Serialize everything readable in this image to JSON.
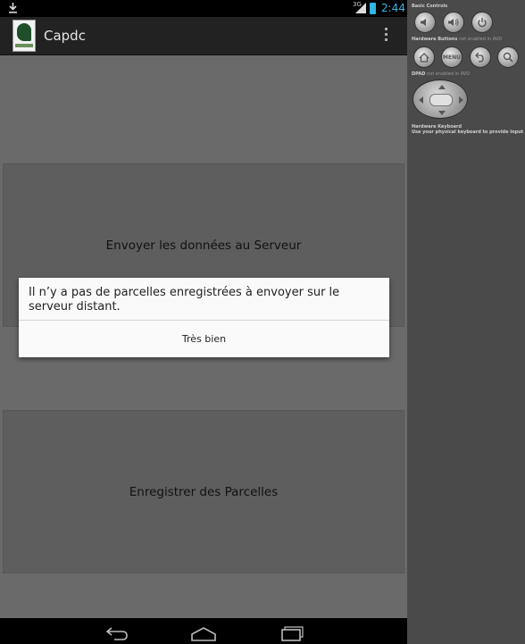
{
  "status_bar": {
    "network": "3G",
    "time": "2:44"
  },
  "app": {
    "title": "Capdc"
  },
  "buttons": {
    "send": "Envoyer les données au Serveur",
    "save": "Enregistrer des Parcelles"
  },
  "dialog": {
    "message": "Il n’y a pas de parcelles enregistrées à envoyer sur le serveur distant.",
    "ok": "Très bien"
  },
  "emulator": {
    "basic_controls": "Basic Controls",
    "hardware_buttons": "Hardware Buttons",
    "hardware_buttons_note": "not enabled in AVD",
    "menu": "MENU",
    "dpad": "DPAD",
    "dpad_note": "not enabled in AVD",
    "hardware_keyboard": "Hardware Keyboard",
    "keyboard_note": "Use your physical keyboard to provide input"
  },
  "colors": {
    "accent": "#33b5e5",
    "action_bar": "#222222",
    "screen_bg": "#6a6a6a",
    "panel_bg": "#4a4a4a"
  },
  "icons": [
    "download-icon",
    "signal-icon",
    "battery-icon",
    "overflow-menu-icon",
    "back-icon",
    "home-icon",
    "recent-apps-icon",
    "volume-down-icon",
    "volume-up-icon",
    "power-icon",
    "search-icon"
  ]
}
